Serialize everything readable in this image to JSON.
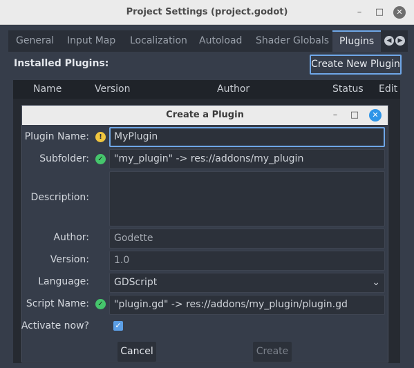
{
  "window": {
    "title": "Project Settings (project.godot)",
    "min_glyph": "–",
    "max_glyph": "□",
    "close_glyph": "✕"
  },
  "tabs": [
    {
      "label": "General"
    },
    {
      "label": "Input Map"
    },
    {
      "label": "Localization"
    },
    {
      "label": "Autoload"
    },
    {
      "label": "Shader Globals"
    },
    {
      "label": "Plugins",
      "active": true
    }
  ],
  "tab_scroll": {
    "left_glyph": "◀",
    "right_glyph": "▶"
  },
  "installed": {
    "label": "Installed Plugins:",
    "create_new_label": "Create New Plugin",
    "columns": [
      "Name",
      "Version",
      "Author",
      "Status",
      "Edit"
    ]
  },
  "dialog": {
    "title": "Create a Plugin",
    "min_glyph": "–",
    "max_glyph": "□",
    "close_glyph": "✕",
    "fields": {
      "plugin_name": {
        "label": "Plugin Name:",
        "value": "MyPlugin",
        "status": "warning"
      },
      "subfolder": {
        "label": "Subfolder:",
        "value": "\"my_plugin\" -> res://addons/my_plugin",
        "status": "ok"
      },
      "description": {
        "label": "Description:",
        "value": ""
      },
      "author": {
        "label": "Author:",
        "value": "Godette"
      },
      "version": {
        "label": "Version:",
        "value": "1.0"
      },
      "language": {
        "label": "Language:",
        "value": "GDScript"
      },
      "script_name": {
        "label": "Script Name:",
        "value": "\"plugin.gd\" -> res://addons/my_plugin/plugin.gd",
        "status": "ok"
      },
      "activate": {
        "label": "Activate now?",
        "checked": true
      }
    },
    "status_glyphs": {
      "warning": "!",
      "ok": "✓"
    },
    "checkbox_glyph": "✓",
    "chevron_glyph": "⌄",
    "cancel_label": "Cancel",
    "create_label": "Create"
  },
  "colors": {
    "accent": "#6fa7e8",
    "warning": "#f0c63f",
    "ok": "#45c56c",
    "dialog_close": "#2e95e8"
  }
}
